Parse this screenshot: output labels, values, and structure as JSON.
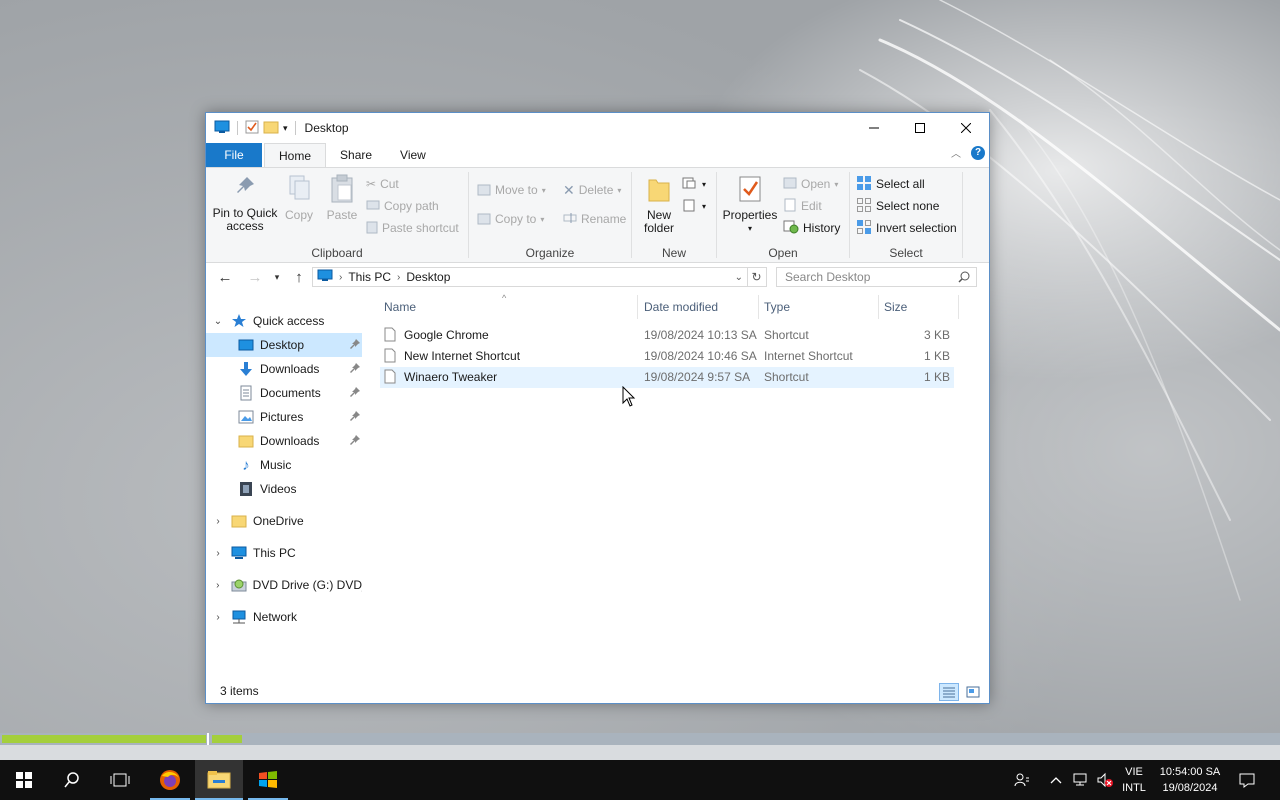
{
  "window": {
    "title": "Desktop",
    "tabs": {
      "file": "File",
      "home": "Home",
      "share": "Share",
      "view": "View"
    },
    "help": "?"
  },
  "ribbon": {
    "clipboard": {
      "label": "Clipboard",
      "pin_line1": "Pin to Quick",
      "pin_line2": "access",
      "copy": "Copy",
      "paste": "Paste",
      "cut": "Cut",
      "copy_path": "Copy path",
      "paste_shortcut": "Paste shortcut"
    },
    "organize": {
      "label": "Organize",
      "move_to": "Move to",
      "copy_to": "Copy to",
      "delete": "Delete",
      "rename": "Rename"
    },
    "new": {
      "label": "New",
      "new_line1": "New",
      "new_line2": "folder"
    },
    "open": {
      "label": "Open",
      "properties": "Properties",
      "open": "Open",
      "edit": "Edit",
      "history": "History"
    },
    "select": {
      "label": "Select",
      "select_all": "Select all",
      "select_none": "Select none",
      "invert": "Invert selection"
    }
  },
  "address": {
    "crumb1": "This PC",
    "crumb2": "Desktop",
    "search_placeholder": "Search Desktop"
  },
  "navpane": {
    "quick_access": "Quick access",
    "items": [
      "Desktop",
      "Downloads",
      "Documents",
      "Pictures",
      "Downloads",
      "Music",
      "Videos"
    ],
    "onedrive": "OneDrive",
    "this_pc": "This PC",
    "dvd": "DVD Drive (G:) DVD_F",
    "network": "Network"
  },
  "columns": {
    "name": "Name",
    "date": "Date modified",
    "type": "Type",
    "size": "Size"
  },
  "files": [
    {
      "name": "Google Chrome",
      "date": "19/08/2024 10:13 SA",
      "type": "Shortcut",
      "size": "3 KB"
    },
    {
      "name": "New Internet Shortcut",
      "date": "19/08/2024 10:46 SA",
      "type": "Internet Shortcut",
      "size": "1 KB"
    },
    {
      "name": "Winaero Tweaker",
      "date": "19/08/2024 9:57 SA",
      "type": "Shortcut",
      "size": "1 KB"
    }
  ],
  "status": {
    "items": "3 items"
  },
  "taskbar": {
    "lang_line1": "VIE",
    "lang_line2": "INTL",
    "time": "10:54:00 SA",
    "date": "19/08/2024"
  },
  "colors": {
    "accent": "#1979ca",
    "selection": "#cce8ff",
    "hover": "#e5f3ff",
    "progress": "#a4cf3c"
  }
}
